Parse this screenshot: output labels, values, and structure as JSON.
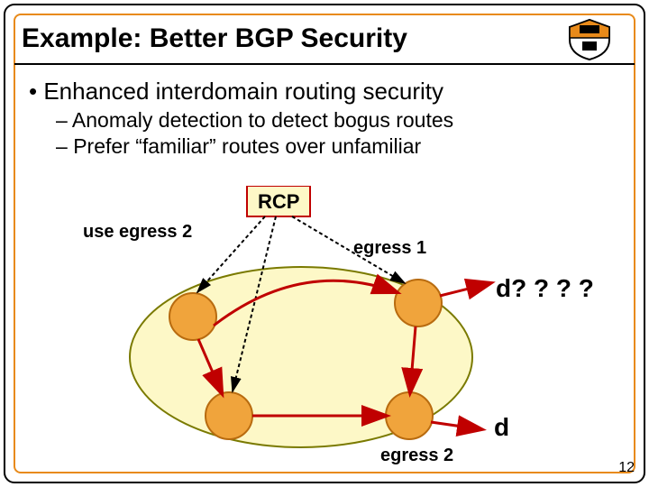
{
  "title": "Example: Better BGP Security",
  "bullets": {
    "main": "Enhanced interdomain routing security",
    "sub1": "Anomaly detection to detect bogus routes",
    "sub2": "Prefer “familiar” routes over unfamiliar"
  },
  "diagram": {
    "rcp_label": "RCP",
    "use_egress2": "use egress 2",
    "egress1": "egress 1",
    "egress2": "egress 2",
    "d_question": "d? ? ? ?",
    "d": "d"
  },
  "page_number": "12",
  "colors": {
    "orange": "#e88a1a",
    "node_fill": "#f0a43c",
    "node_stroke": "#b86b0f",
    "cloud_fill": "#fdf8c7",
    "cloud_stroke": "#7a7a00",
    "rcp_fill": "#fdf8c7",
    "rcp_stroke": "#c00000",
    "link_stroke": "#c00000"
  }
}
